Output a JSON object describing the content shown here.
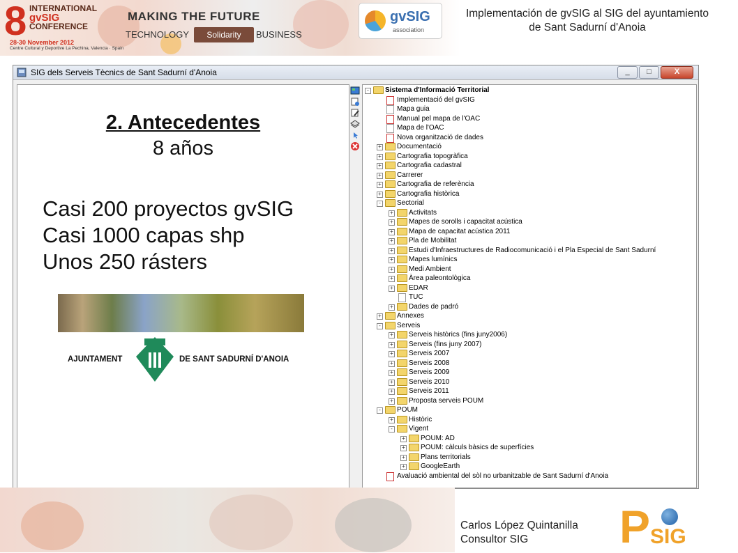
{
  "header": {
    "conference_number": "8",
    "conference_lines": [
      "INTERNATIONAL",
      "gvSIG",
      "CONFERENCE"
    ],
    "conference_date": "28-30 November 2012",
    "conference_venue": "Centre Cultural y Deportive La Pechina, Valencia · Spain",
    "slogan_main": "MAKING THE FUTURE",
    "slogan_technology": "TECHNOLOGY",
    "slogan_solidarity": "Solidarity",
    "slogan_business": "BUSINESS",
    "gvsig_logo_text": "gvSIG",
    "gvsig_logo_sub": "association",
    "slide_title": "Implementación de gvSIG al SIG del ayuntamiento de Sant Sadurní d'Anoia"
  },
  "window": {
    "title": "SIG dels Serveis Tècnics de Sant Sadurní d'Anoia",
    "btn_minimize": "_",
    "btn_maximize": "□",
    "btn_close": "X"
  },
  "content": {
    "heading": "2. Antecedentes",
    "years": "8 años",
    "stats": [
      "Casi 200 proyectos gvSIG",
      "Casi 1000 capas shp",
      "Unos 250 rásters"
    ],
    "ajuntament_left": "AJUNTAMENT",
    "ajuntament_right": "DE SANT SADURNÍ D'ANOIA"
  },
  "tree": {
    "items": [
      {
        "label": "Sistema d'Informació Territorial",
        "level": 0,
        "type": "folder",
        "exp": "-",
        "bold": true
      },
      {
        "label": "Implementació del gvSIG",
        "level": 1,
        "type": "doc-red",
        "exp": ""
      },
      {
        "label": "Mapa guia",
        "level": 1,
        "type": "doc",
        "exp": ""
      },
      {
        "label": "Manual pel mapa de l'OAC",
        "level": 1,
        "type": "doc-red",
        "exp": ""
      },
      {
        "label": "Mapa de l'OAC",
        "level": 1,
        "type": "doc",
        "exp": ""
      },
      {
        "label": "Nova organització de dades",
        "level": 1,
        "type": "doc-red",
        "exp": ""
      },
      {
        "label": "Documentació",
        "level": 1,
        "type": "folder",
        "exp": "+"
      },
      {
        "label": "Cartografia topogràfica",
        "level": 1,
        "type": "folder",
        "exp": "+"
      },
      {
        "label": "Cartografia cadastral",
        "level": 1,
        "type": "folder",
        "exp": "+"
      },
      {
        "label": "Carrerer",
        "level": 1,
        "type": "folder",
        "exp": "+"
      },
      {
        "label": "Cartografia de referència",
        "level": 1,
        "type": "folder",
        "exp": "+"
      },
      {
        "label": "Cartografia històrica",
        "level": 1,
        "type": "folder",
        "exp": "+"
      },
      {
        "label": "Sectorial",
        "level": 1,
        "type": "folder",
        "exp": "-"
      },
      {
        "label": "Activitats",
        "level": 2,
        "type": "folder",
        "exp": "+"
      },
      {
        "label": "Mapes de sorolls i capacitat acústica",
        "level": 2,
        "type": "folder",
        "exp": "+"
      },
      {
        "label": "Mapa de capacitat acústica 2011",
        "level": 2,
        "type": "folder",
        "exp": "+"
      },
      {
        "label": "Pla de Mobilitat",
        "level": 2,
        "type": "folder",
        "exp": "+"
      },
      {
        "label": "Estudi d'Infraestructures de Radiocomunicació i el Pla Especial de Sant Sadurní",
        "level": 2,
        "type": "folder",
        "exp": "+"
      },
      {
        "label": "Mapes lumínics",
        "level": 2,
        "type": "folder",
        "exp": "+"
      },
      {
        "label": "Medi Ambient",
        "level": 2,
        "type": "folder",
        "exp": "+"
      },
      {
        "label": "Àrea paleontològica",
        "level": 2,
        "type": "folder",
        "exp": "+"
      },
      {
        "label": "EDAR",
        "level": 2,
        "type": "folder",
        "exp": "+"
      },
      {
        "label": "TUC",
        "level": 2,
        "type": "doc",
        "exp": ""
      },
      {
        "label": "Dades de padró",
        "level": 2,
        "type": "folder",
        "exp": "+"
      },
      {
        "label": "Annexes",
        "level": 1,
        "type": "folder",
        "exp": "+"
      },
      {
        "label": "Serveis",
        "level": 1,
        "type": "folder",
        "exp": "-"
      },
      {
        "label": "Serveis històrics (fins juny2006)",
        "level": 2,
        "type": "folder",
        "exp": "+"
      },
      {
        "label": "Serveis (fins juny 2007)",
        "level": 2,
        "type": "folder",
        "exp": "+"
      },
      {
        "label": "Serveis 2007",
        "level": 2,
        "type": "folder",
        "exp": "+"
      },
      {
        "label": "Serveis 2008",
        "level": 2,
        "type": "folder",
        "exp": "+"
      },
      {
        "label": "Serveis 2009",
        "level": 2,
        "type": "folder",
        "exp": "+"
      },
      {
        "label": "Serveis 2010",
        "level": 2,
        "type": "folder",
        "exp": "+"
      },
      {
        "label": "Serveis 2011",
        "level": 2,
        "type": "folder",
        "exp": "+"
      },
      {
        "label": "Proposta serveis POUM",
        "level": 2,
        "type": "folder",
        "exp": "+"
      },
      {
        "label": "POUM",
        "level": 1,
        "type": "folder",
        "exp": "-"
      },
      {
        "label": "Històric",
        "level": 2,
        "type": "folder",
        "exp": "+"
      },
      {
        "label": "Vigent",
        "level": 2,
        "type": "folder",
        "exp": "-"
      },
      {
        "label": "POUM: AD",
        "level": 3,
        "type": "folder",
        "exp": "+"
      },
      {
        "label": "POUM: càlculs bàsics de superfícies",
        "level": 3,
        "type": "folder",
        "exp": "+"
      },
      {
        "label": "Plans territorials",
        "level": 3,
        "type": "folder",
        "exp": "+"
      },
      {
        "label": "GoogleEarth",
        "level": 3,
        "type": "folder",
        "exp": "+"
      },
      {
        "label": "Avaluació ambiental del sòl no urbanitzable de Sant Sadurní d'Anoia",
        "level": 1,
        "type": "doc-red",
        "exp": ""
      }
    ]
  },
  "footer": {
    "author_name": "Carlos López Quintanilla",
    "author_role": "Consultor SIG",
    "psig_logo": "PSIG"
  },
  "colors": {
    "accent_red": "#d0301f",
    "folder_yellow": "#f3d56b",
    "psig_orange": "#f0a22a"
  }
}
